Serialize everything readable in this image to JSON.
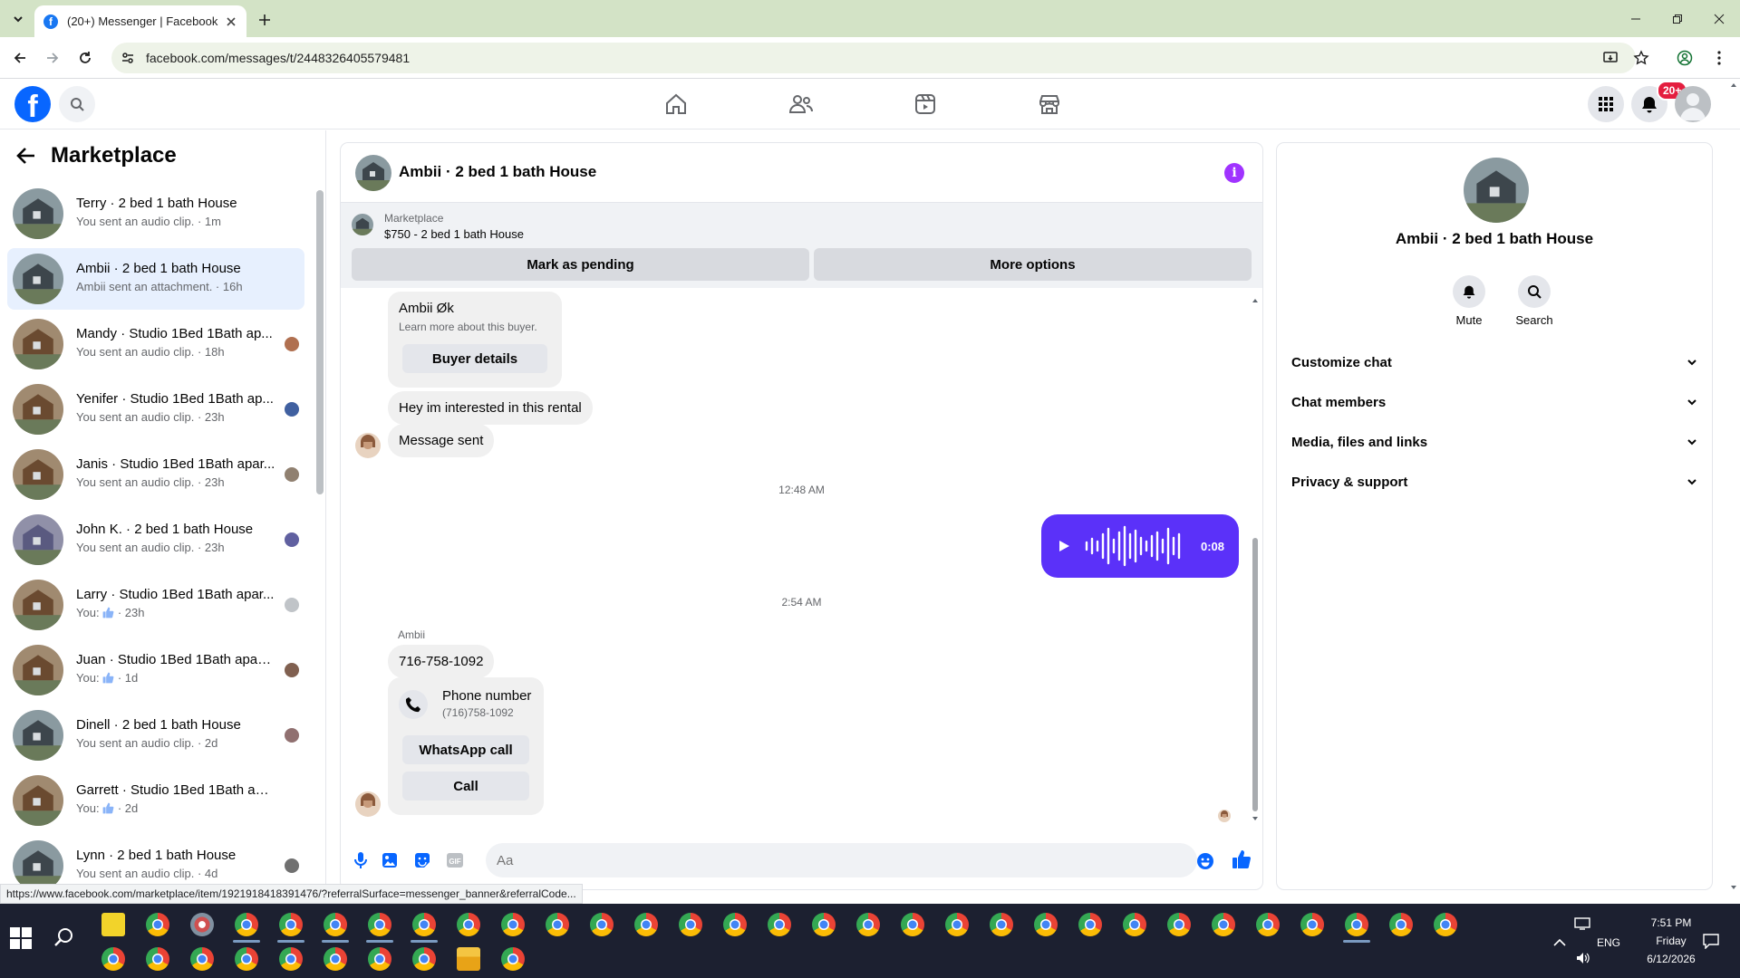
{
  "browser": {
    "tab_title": "(20+) Messenger | Facebook",
    "url": "facebook.com/messages/t/2448326405579481",
    "status_url": "https://www.facebook.com/marketplace/item/1921918418391476/?referralSurface=messenger_banner&referralCode..."
  },
  "fbnav": {
    "notif_badge": "20+"
  },
  "left": {
    "title": "Marketplace",
    "conversations": [
      {
        "name": "Terry · 2 bed 1 bath House",
        "sub": "You sent an audio clip. · 1m"
      },
      {
        "name": "Ambii · 2 bed 1 bath House",
        "sub": "Ambii sent an attachment. · 16h"
      },
      {
        "name": "Mandy · Studio 1Bed 1Bath ap...",
        "sub": "You sent an audio clip. · 18h"
      },
      {
        "name": "Yenifer · Studio 1Bed 1Bath ap...",
        "sub": "You sent an audio clip. · 23h"
      },
      {
        "name": "Janis · Studio 1Bed 1Bath apar...",
        "sub": "You sent an audio clip. · 23h"
      },
      {
        "name": "John K. · 2 bed 1 bath House",
        "sub": "You sent an audio clip. · 23h"
      },
      {
        "name": "Larry · Studio 1Bed 1Bath apar...",
        "sub_prefix": "You:",
        "sub_suffix": "· 23h"
      },
      {
        "name": "Juan · Studio 1Bed 1Bath apart...",
        "sub_prefix": "You:",
        "sub_suffix": "· 1d"
      },
      {
        "name": "Dinell · 2 bed 1 bath House",
        "sub": "You sent an audio clip. · 2d"
      },
      {
        "name": "Garrett · Studio 1Bed 1Bath apar...",
        "sub_prefix": "You:",
        "sub_suffix": "· 2d"
      },
      {
        "name": "Lynn · 2 bed 1 bath House",
        "sub": "You sent an audio clip. · 4d"
      }
    ]
  },
  "chat": {
    "title": "Ambii · 2 bed 1 bath House",
    "banner_label": "Marketplace",
    "banner_price": "$750 - 2 bed 1 bath House",
    "mark_pending": "Mark as pending",
    "more_options": "More options",
    "buyer_card": {
      "name": "Ambii Øk",
      "sub": "Learn more about this buyer.",
      "button": "Buyer details"
    },
    "msg_interested": "Hey im interested in this rental",
    "msg_sent": "Message sent",
    "time1": "12:48 AM",
    "audio_duration": "0:08",
    "time2": "2:54 AM",
    "sender": "Ambii",
    "phone_msg": "716-758-1092",
    "phone_card": {
      "title": "Phone number",
      "number": "(716)758-1092",
      "whatsapp": "WhatsApp call",
      "call": "Call"
    },
    "composer_placeholder": "Aa"
  },
  "right": {
    "name": "Ambii · 2 bed 1 bath House",
    "mute": "Mute",
    "search": "Search",
    "rows": [
      "Customize chat",
      "Chat members",
      "Media, files and links",
      "Privacy & support"
    ]
  },
  "taskbar": {
    "time": "7:51 PM",
    "day": "Friday",
    "date": "6/12/2026",
    "lang": "ENG"
  },
  "colors": {
    "accent": "#0866ff",
    "audio_bubble": "#5b31f9",
    "info": "#a033ff",
    "badge": "#e41e3f"
  }
}
